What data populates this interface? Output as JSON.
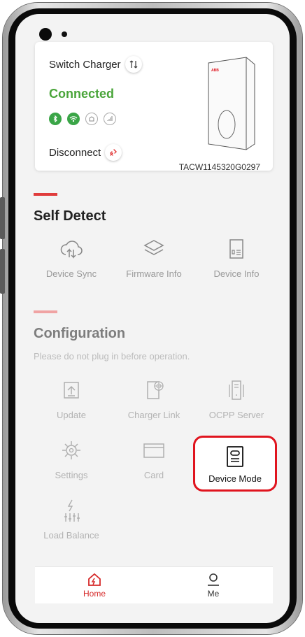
{
  "charger": {
    "switch_label": "Switch Charger",
    "status": "Connected",
    "disconnect_label": "Disconnect",
    "serial": "TACW1145320G0297",
    "brand_mark": "ABB",
    "status_icons": [
      "bluetooth-icon",
      "wifi-icon",
      "ethernet-icon",
      "cellular-icon"
    ]
  },
  "self_detect": {
    "title": "Self Detect",
    "accent_color": "#e03c3c",
    "items": [
      {
        "label": "Device Sync",
        "icon": "cloud-sync-icon"
      },
      {
        "label": "Firmware Info",
        "icon": "layers-icon"
      },
      {
        "label": "Device Info",
        "icon": "document-icon"
      }
    ]
  },
  "configuration": {
    "title": "Configuration",
    "note": "Please do not plug in before operation.",
    "accent_color": "#f0a3a3",
    "items": [
      {
        "label": "Update",
        "icon": "upload-box-icon"
      },
      {
        "label": "Charger Link",
        "icon": "globe-card-icon"
      },
      {
        "label": "OCPP Server",
        "icon": "server-icon"
      },
      {
        "label": "Settings",
        "icon": "gear-icon"
      },
      {
        "label": "Card",
        "icon": "card-icon"
      },
      {
        "label": "Device Mode",
        "icon": "device-mode-icon"
      },
      {
        "label": "Load Balance",
        "icon": "load-balance-icon"
      }
    ]
  },
  "nav": {
    "home_label": "Home",
    "me_label": "Me",
    "active_color": "#d62a2a"
  }
}
